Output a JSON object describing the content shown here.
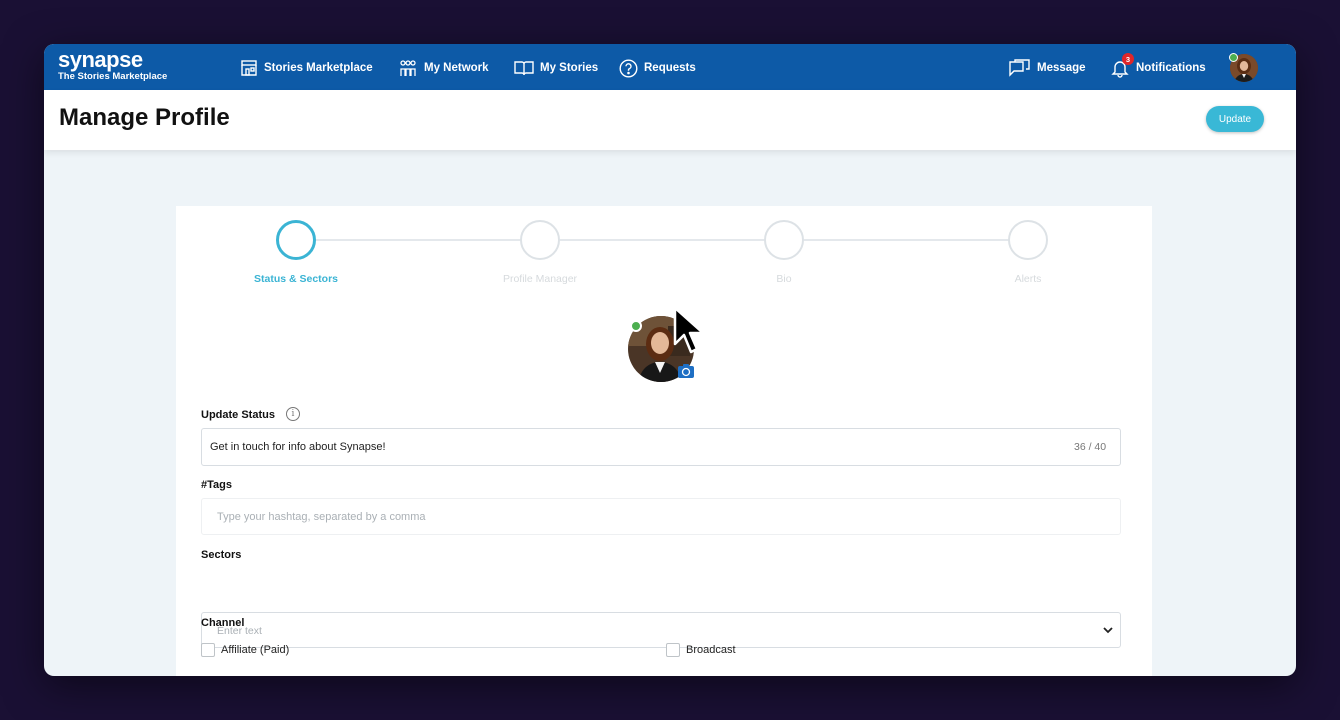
{
  "app": {
    "logo": "synapse",
    "tagline": "The Stories Marketplace"
  },
  "nav": {
    "items": [
      {
        "label": "Stories Marketplace",
        "icon": "storefront-icon"
      },
      {
        "label": "My Network",
        "icon": "people-icon"
      },
      {
        "label": "My Stories",
        "icon": "book-icon"
      },
      {
        "label": "Requests",
        "icon": "question-icon"
      }
    ],
    "message_label": "Message",
    "notifications_label": "Notifications",
    "notifications_count": "3"
  },
  "header": {
    "title": "Manage Profile",
    "update_label": "Update"
  },
  "stepper": {
    "steps": [
      "Status & Sectors",
      "Profile Manager",
      "Bio",
      "Alerts"
    ],
    "active_index": 0
  },
  "form": {
    "status": {
      "label": "Update Status",
      "value": "Get in touch for info about Synapse!",
      "counter": "36 / 40"
    },
    "tags": {
      "label": "#Tags",
      "placeholder": "Type your hashtag, separated by a comma"
    },
    "sectors": {
      "label": "Sectors",
      "placeholder": "Enter text"
    },
    "channel": {
      "label": "Channel",
      "options": [
        {
          "label": "Affiliate (Paid)",
          "checked": false
        },
        {
          "label": "Broadcast",
          "checked": false
        }
      ]
    }
  },
  "colors": {
    "nav_bg": "#0d5aa7",
    "accent": "#3bb4d4",
    "online": "#4caf50",
    "badge": "#e0262a"
  }
}
